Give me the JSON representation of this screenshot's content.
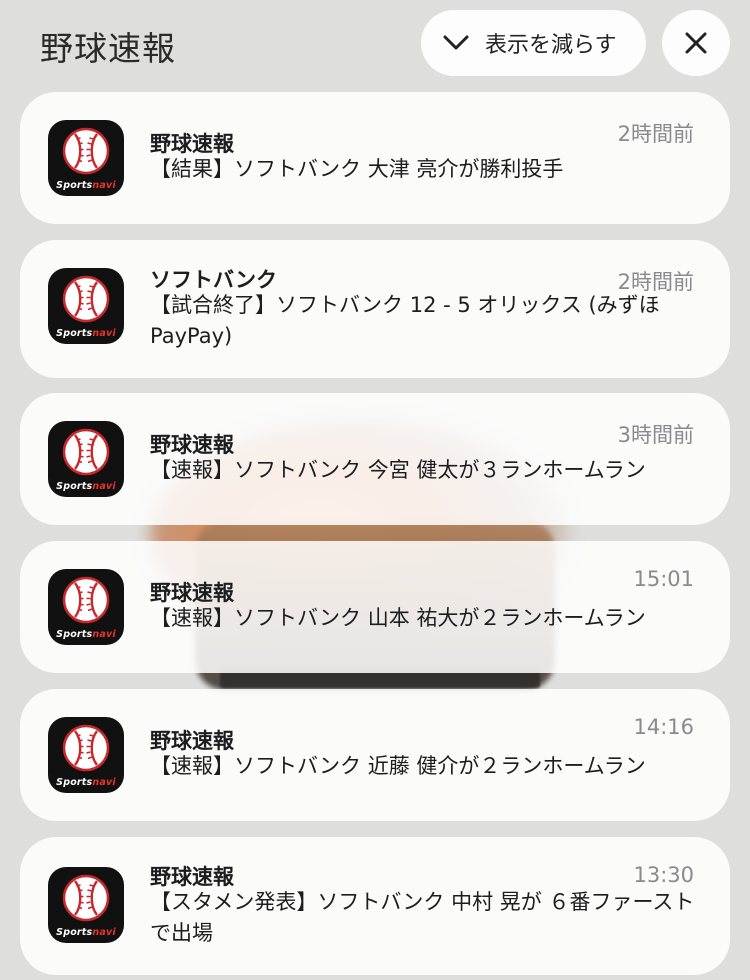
{
  "header": {
    "title": "野球速報",
    "show_less_label": "表示を減らす",
    "show_less_icon": "chevron-down-icon",
    "close_icon": "close-icon"
  },
  "app": {
    "icon_name": "sportsnavi-baseball-icon",
    "brand_sports": "Sports",
    "brand_navi": "navi",
    "brand_color": "#e8342a"
  },
  "notifications": [
    {
      "title": "野球速報",
      "time": "2時間前",
      "body": "【結果】ソフトバンク 大津 亮介が勝利投手"
    },
    {
      "title": "ソフトバンク",
      "time": "2時間前",
      "body": "【試合終了】ソフトバンク 12 - 5 オリックス (みずほ PayPay)"
    },
    {
      "title": "野球速報",
      "time": "3時間前",
      "body": "【速報】ソフトバンク 今宮 健太が３ランホームラン"
    },
    {
      "title": "野球速報",
      "time": "15:01",
      "body": "【速報】ソフトバンク 山本 祐大が２ランホームラン"
    },
    {
      "title": "野球速報",
      "time": "14:16",
      "body": "【速報】ソフトバンク 近藤 健介が２ランホームラン"
    },
    {
      "title": "野球速報",
      "time": "13:30",
      "body": "【スタメン発表】ソフトバンク 中村 晃が ６番ファーストで出場"
    }
  ]
}
